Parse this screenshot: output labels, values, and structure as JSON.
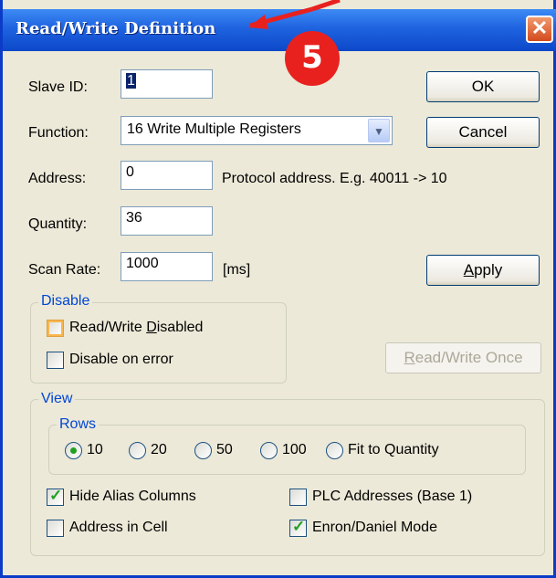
{
  "window": {
    "title": "Read/Write Definition",
    "close_glyph": "✕"
  },
  "annotation": {
    "badge_number": "5"
  },
  "fields": {
    "slave_id": {
      "label": "Slave ID:",
      "value": "1"
    },
    "function": {
      "label": "Function:",
      "value": "16 Write Multiple Registers"
    },
    "address": {
      "label": "Address:",
      "value": "0",
      "hint": "Protocol address. E.g. 40011 -> 10"
    },
    "quantity": {
      "label": "Quantity:",
      "value": "36"
    },
    "scan_rate": {
      "label": "Scan Rate:",
      "value": "1000",
      "unit": "[ms]"
    }
  },
  "buttons": {
    "ok": "OK",
    "cancel": "Cancel",
    "apply_pre": "",
    "apply_key": "A",
    "apply_post": "pply",
    "rw_once_key": "R",
    "rw_once_post": "ead/Write Once"
  },
  "disable_group": {
    "title": "Disable",
    "rw_disabled_pre": "Read/Write ",
    "rw_disabled_key": "D",
    "rw_disabled_post": "isabled",
    "rw_disabled_checked": false,
    "disable_on_error": "Disable on error",
    "disable_on_error_checked": false
  },
  "view_group": {
    "title": "View",
    "rows": {
      "title": "Rows",
      "options": [
        "10",
        "20",
        "50",
        "100",
        "Fit to Quantity"
      ],
      "selected": "10"
    },
    "hide_alias_columns": "Hide Alias Columns",
    "hide_alias_columns_checked": true,
    "address_in_cell": "Address in Cell",
    "address_in_cell_checked": false,
    "plc_addresses": "PLC Addresses (Base 1)",
    "plc_addresses_checked": false,
    "enron_daniel": "Enron/Daniel Mode",
    "enron_daniel_checked": true
  },
  "colors": {
    "title_bar": "#1f63e0",
    "badge": "#e8211f",
    "group_title": "#0046d5",
    "arrow": "#e8211f"
  }
}
